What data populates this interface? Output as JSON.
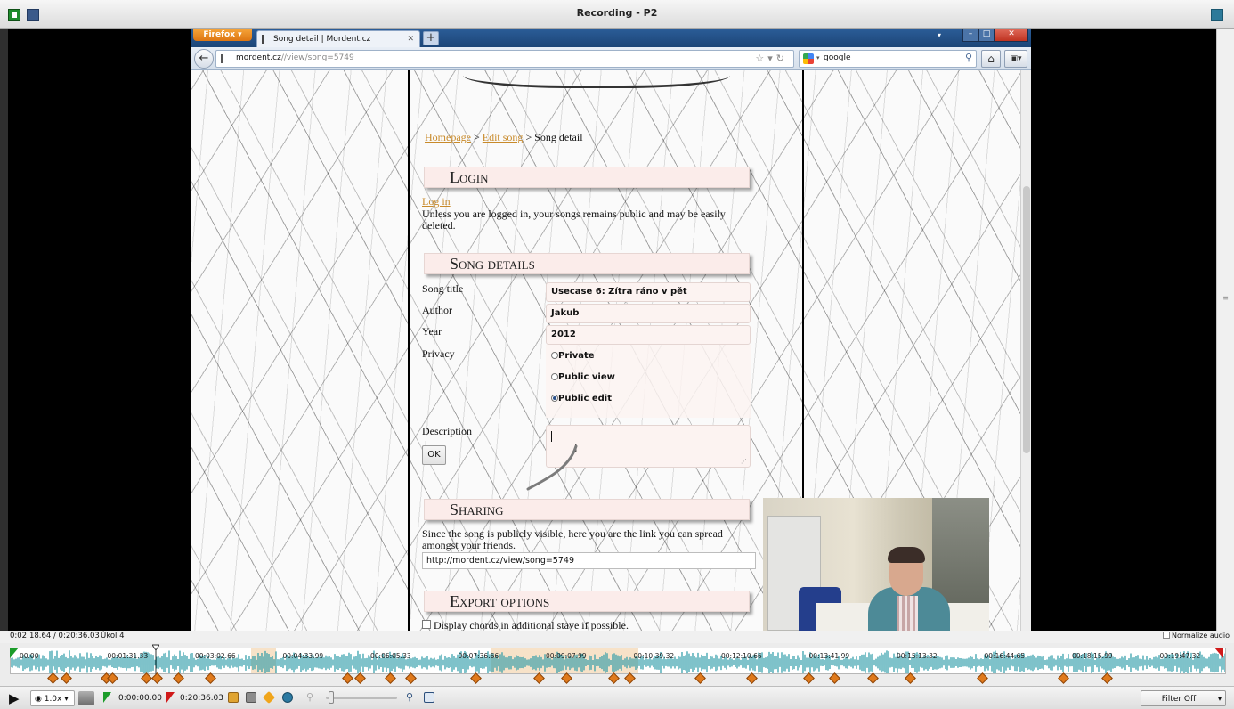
{
  "recorder": {
    "title": "Recording - P2",
    "status_time": "0:02:18.64 / 0:20:36.03",
    "task_label": "Úkol 4",
    "normalize_label": "Normalize audio",
    "timeline_labels": [
      "00.00",
      "00:01:31.33",
      "00:03:02.66",
      "00:04:33.99",
      "00:06:05.33",
      "00:07:36.66",
      "00:09:07.99",
      "00:10:39.32",
      "00:12:10.66",
      "00:13:41.99",
      "00:15:13.32",
      "00:16:44.65",
      "00:18:15.99",
      "00:19:47.32"
    ],
    "playhead_fraction": 0.112,
    "toolbar": {
      "play_icon": "play-icon",
      "speed": "1.0x",
      "start_time": "0:00:00.00",
      "end_time": "0:20:36.03",
      "filter": "Filter Off"
    },
    "colors": {
      "waveform": "#2a9aa6",
      "marker": "#e07a1c",
      "start_flag": "#1c9c2a",
      "end_flag": "#d01a1a"
    }
  },
  "browser": {
    "menu_button": "Firefox",
    "tab_title": "Song detail | Mordent.cz",
    "new_tab": "+",
    "url_host": "mordent.cz",
    "url_path": "//view/song=5749",
    "search_text": "google"
  },
  "page": {
    "breadcrumb": {
      "home": "Homepage",
      "sep1": " > ",
      "edit": "Edit song",
      "sep2": " > ",
      "current": "Song detail"
    },
    "login": {
      "heading": "Login",
      "link": "Log in",
      "note": "Unless you are logged in, your songs remains public and may be easily deleted."
    },
    "song_details": {
      "heading": "Song details",
      "title_label": "Song title",
      "title_value": "Usecase 6: Zítra ráno v pět",
      "author_label": "Author",
      "author_value": "Jakub",
      "year_label": "Year",
      "year_value": "2012",
      "privacy_label": "Privacy",
      "privacy_options": [
        "Private",
        "Public view",
        "Public edit"
      ],
      "privacy_selected": "Public edit",
      "description_label": "Description",
      "ok": "OK"
    },
    "sharing": {
      "heading": "Sharing",
      "note": "Since the song is publicly visible, here you are the link you can spread amongst your friends.",
      "url": "http://mordent.cz/view/song=5749"
    },
    "export": {
      "heading": "Export options",
      "option": "Display chords in additional stave if possible."
    }
  }
}
